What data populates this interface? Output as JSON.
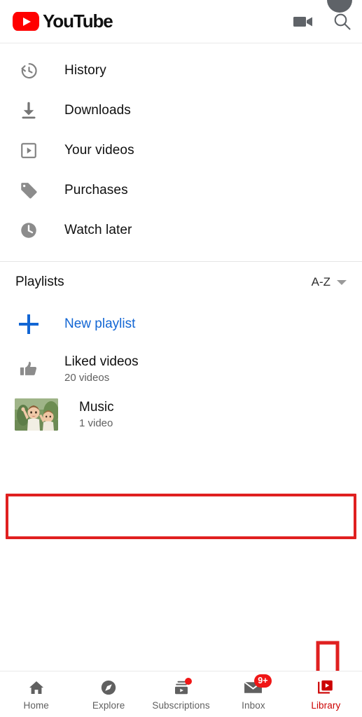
{
  "header": {
    "logo_text": "YouTube",
    "logo_color": "#ff0000",
    "camera_icon": "video-camera-icon",
    "search_icon": "search-icon",
    "avatar_icon": "account-avatar"
  },
  "library": {
    "items": [
      {
        "label": "History",
        "icon": "history-clock-icon"
      },
      {
        "label": "Downloads",
        "icon": "download-icon"
      },
      {
        "label": "Your videos",
        "icon": "your-videos-icon"
      },
      {
        "label": "Purchases",
        "icon": "price-tag-icon"
      },
      {
        "label": "Watch later",
        "icon": "watch-later-clock-icon"
      }
    ]
  },
  "playlists": {
    "section_title": "Playlists",
    "sort_label": "A-Z",
    "sort_icon": "chevron-down-icon",
    "new_playlist_label": "New playlist",
    "new_playlist_icon": "plus-icon",
    "new_playlist_color": "#1266d4",
    "items": [
      {
        "title": "Liked videos",
        "count": "20 videos",
        "icon": "thumbs-up-icon",
        "thumbnail": false
      },
      {
        "title": "Music",
        "count": "1 video",
        "icon": "playlist-thumbnail",
        "thumbnail": true
      }
    ]
  },
  "annotations": {
    "highlight_color": "#e02020",
    "highlight_target": "Music",
    "arrow_color": "#e02020",
    "arrow_target": "Library"
  },
  "bottom_nav": {
    "active": "Library",
    "active_color": "#cc0000",
    "tabs": [
      {
        "label": "Home",
        "icon": "home-icon",
        "badge": "",
        "dot": false
      },
      {
        "label": "Explore",
        "icon": "explore-compass-icon",
        "badge": "",
        "dot": false
      },
      {
        "label": "Subscriptions",
        "icon": "subscriptions-icon",
        "badge": "",
        "dot": true
      },
      {
        "label": "Inbox",
        "icon": "inbox-envelope-icon",
        "badge": "9+",
        "dot": false
      },
      {
        "label": "Library",
        "icon": "library-icon",
        "badge": "",
        "dot": false
      }
    ]
  }
}
